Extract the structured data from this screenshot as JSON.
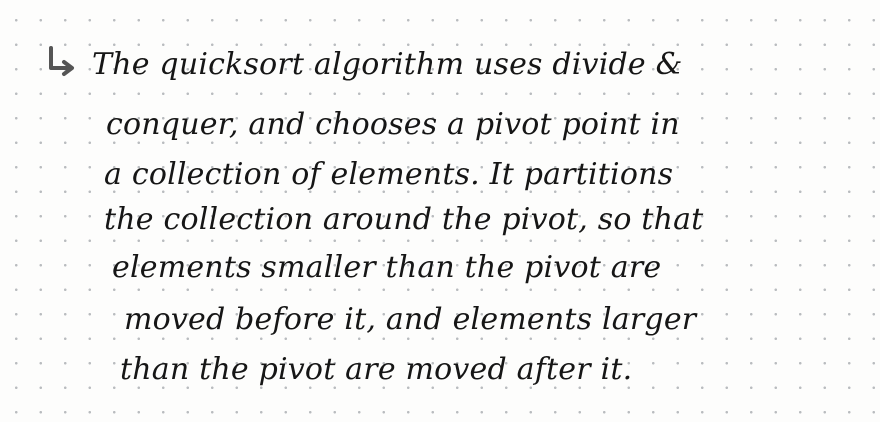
{
  "note": {
    "arrow_icon": "return-arrow-icon",
    "lines": [
      "The quicksort algorithm uses divide &",
      "conquer, and chooses a pivot point in",
      "a collection of elements. It partitions",
      "the collection around the pivot, so that",
      "elements smaller than the pivot are",
      "moved before it, and elements larger",
      "than the pivot are moved after it."
    ]
  }
}
